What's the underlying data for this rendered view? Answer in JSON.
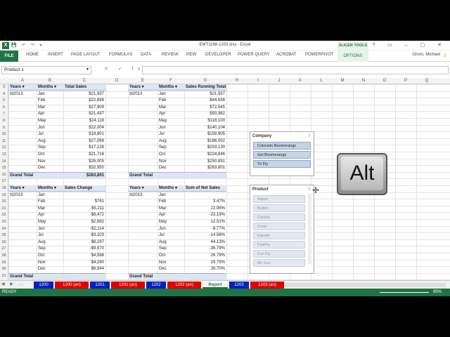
{
  "window": {
    "title": "EMT1198-1203.xlsx - Excel",
    "contextual_group": "SLICER TOOLS",
    "user": "Girvin, Michael"
  },
  "ribbon": {
    "tabs": [
      "HOME",
      "INSERT",
      "PAGE LAYOUT",
      "FORMULAS",
      "DATA",
      "REVIEW",
      "VIEW",
      "DEVELOPER",
      "POWER QUERY",
      "ACROBAT",
      "POWERPIVOT"
    ],
    "file": "FILE",
    "options": "OPTIONS"
  },
  "formula_bar": {
    "name_box": "Product 1",
    "formula": ""
  },
  "columns": [
    "A",
    "B",
    "C",
    "D",
    "E",
    "F",
    "G",
    "H",
    "I",
    "J",
    "K",
    "L",
    "M",
    "N",
    "O",
    "P",
    "Q"
  ],
  "rows": [
    3,
    4,
    5,
    6,
    7,
    8,
    9,
    10,
    11,
    12,
    13,
    14,
    15,
    16,
    17,
    18,
    19,
    20,
    21,
    22,
    23,
    24,
    25,
    26,
    27,
    28,
    29,
    30,
    31
  ],
  "pivot1": {
    "headers": [
      "Years",
      "Months",
      "Total Sales"
    ],
    "year": "⊟2013",
    "months": [
      "Jan",
      "Feb",
      "Mar",
      "Apr",
      "May",
      "Jun",
      "Jul",
      "Aug",
      "Sep",
      "Oct",
      "Nov",
      "Dec"
    ],
    "values": [
      "$21,937",
      "$22,698",
      "$27,909",
      "$21,437",
      "$24,118",
      "$22,004",
      "$18,801",
      "$27,098",
      "$17,128",
      "$21,716",
      "$26,005",
      "$32,950"
    ],
    "grand_label": "Grand Total",
    "grand_value": "$283,801"
  },
  "pivot2": {
    "headers": [
      "Years",
      "Months",
      "Sales Running Total"
    ],
    "year": "⊟2013",
    "months": [
      "Jan",
      "Feb",
      "Mar",
      "Apr",
      "May",
      "Jun",
      "Jul",
      "Aug",
      "Sep",
      "Oct",
      "Nov",
      "Dec"
    ],
    "values": [
      "$21,937",
      "$44,636",
      "$72,545",
      "$93,982",
      "$118,100",
      "$140,104",
      "$158,905",
      "$186,002",
      "$203,130",
      "$224,846",
      "$250,851",
      "$283,801"
    ],
    "grand_label": "Grand Total"
  },
  "pivot3": {
    "headers": [
      "Years",
      "Months",
      "Sales Change"
    ],
    "year": "⊟2013",
    "months": [
      "Jan",
      "Feb",
      "Mar",
      "Apr",
      "May",
      "Jun",
      "Jul",
      "Aug",
      "Sep",
      "Oct",
      "Nov",
      "Dec"
    ],
    "values": [
      "",
      "$761",
      "$5,211",
      "-$6,472",
      "$2,682",
      "-$2,114",
      "-$3,203",
      "$8,297",
      "-$9,970",
      "$4,588",
      "$4,290",
      "$6,944"
    ],
    "grand_label": "Grand Total"
  },
  "pivot4": {
    "headers": [
      "Years",
      "Months",
      "Sum of Net Sales"
    ],
    "year": "⊟2013",
    "months": [
      "Jan",
      "Feb",
      "Mar",
      "Apr",
      "May",
      "Jun",
      "Jul",
      "Aug",
      "Sep",
      "Oct",
      "Nov",
      "Dec"
    ],
    "values": [
      "",
      "3.47%",
      "22.96%",
      "-23.19%",
      "12.51%",
      "-8.77%",
      "-14.56%",
      "44.13%",
      "-36.79%",
      "26.79%",
      "19.75%",
      "26.70%"
    ],
    "grand_label": "Grand Total"
  },
  "slicer_company": {
    "title": "Company",
    "items": [
      "Colorado Boomerangs",
      "Gel Boomerangs",
      "Tri Fly"
    ]
  },
  "slicer_product": {
    "title": "Product",
    "items": [
      "Aspen",
      "Bellen",
      "Carlota",
      "Crest",
      "Darnell",
      "FastFly",
      "Fun Fly",
      "Mt. Fun"
    ]
  },
  "key_overlay": {
    "label": "Alt"
  },
  "sheet_tabs": [
    {
      "label": "1200",
      "style": "blue"
    },
    {
      "label": "1200 (an)",
      "style": "red"
    },
    {
      "label": "1201",
      "style": "blue"
    },
    {
      "label": "1201 (an)",
      "style": "red"
    },
    {
      "label": "1202",
      "style": "blue"
    },
    {
      "label": "1202 (an)",
      "style": "red"
    },
    {
      "label": "Report",
      "style": "active"
    },
    {
      "label": "1203",
      "style": "blue"
    },
    {
      "label": "1203 (an)",
      "style": "red"
    }
  ],
  "status": {
    "ready": "READY",
    "zoom": "95%"
  }
}
